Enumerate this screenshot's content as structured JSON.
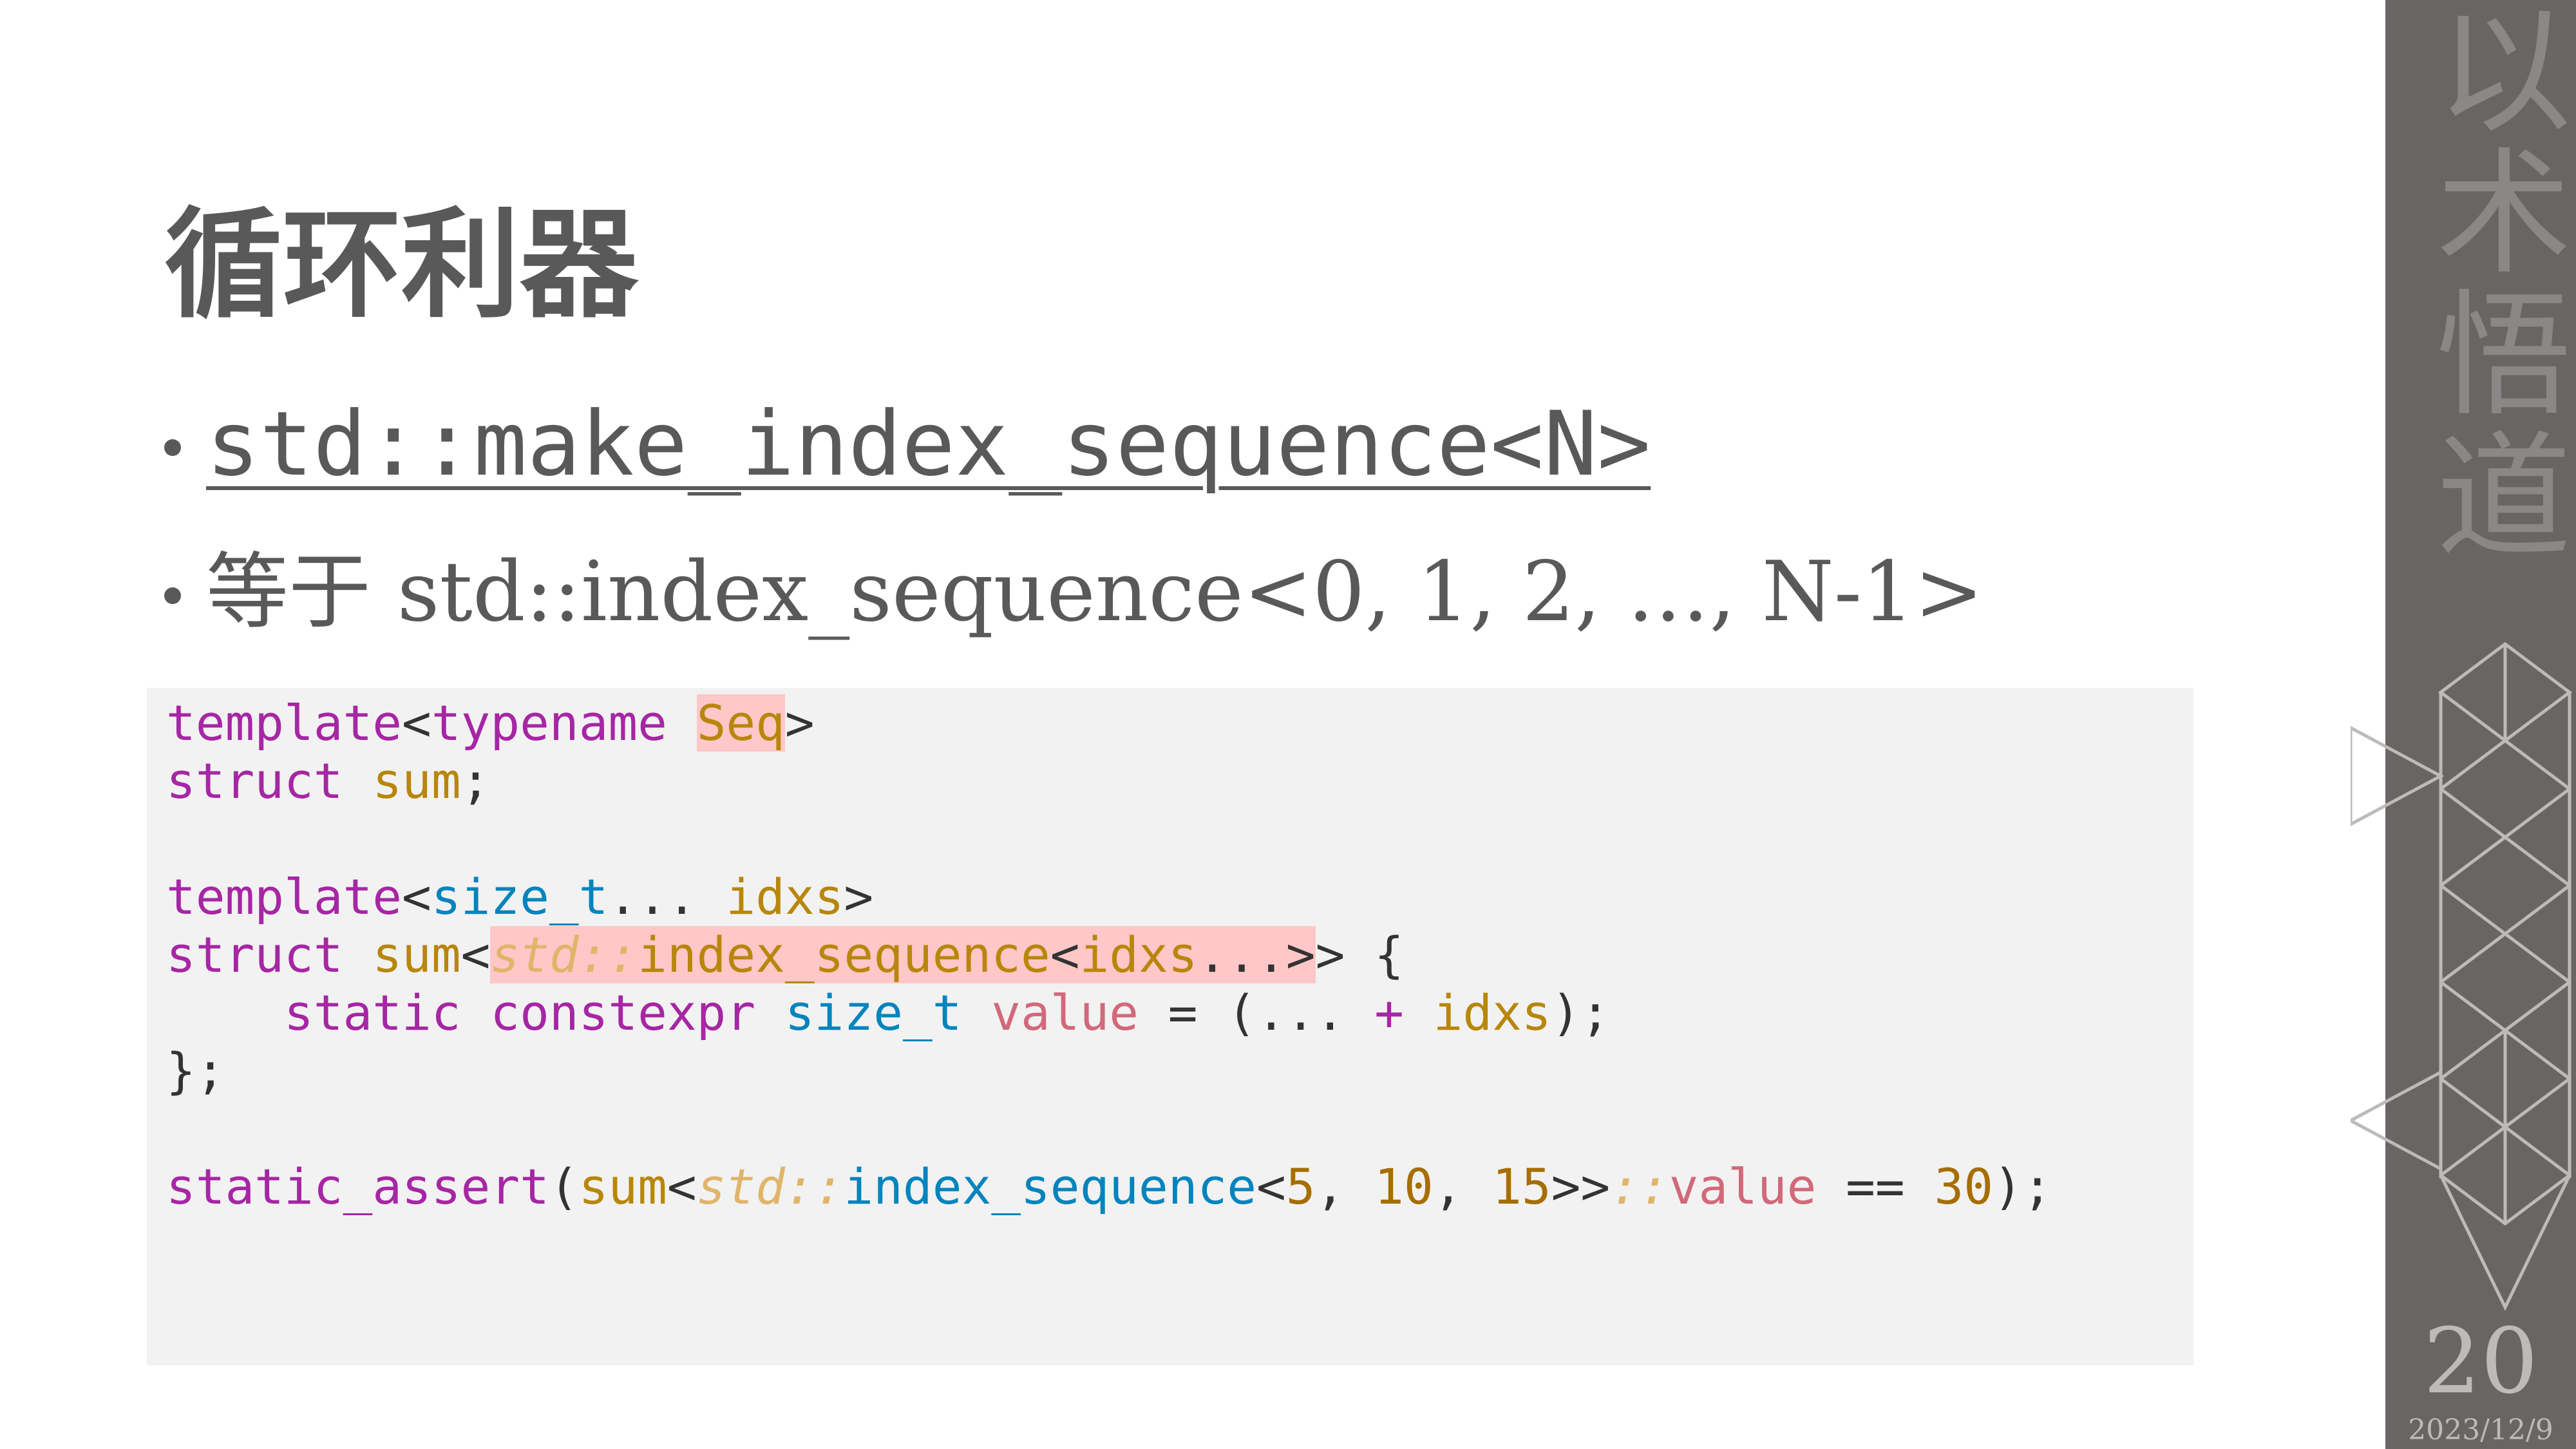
{
  "slide": {
    "title": "循环利器",
    "bullets": [
      "std::make_index_sequence<N>",
      "等于 std::index_sequence<0, 1, 2, …, N-1>"
    ],
    "code": {
      "l1": {
        "a": "template",
        "b": "<",
        "c": "typename",
        "d": " ",
        "e": "Seq",
        "f": ">"
      },
      "l2": {
        "a": "struct",
        "b": " ",
        "c": "sum",
        "d": ";"
      },
      "l4": {
        "a": "template",
        "b": "<",
        "c": "size_t",
        "d": "... ",
        "e": "idxs",
        "f": ">"
      },
      "l5": {
        "a": "struct",
        "b": " ",
        "c": "sum",
        "d": "<",
        "e": "std::",
        "f": "index_sequence",
        "g": "<",
        "h": "idxs",
        "i": "...>",
        "j": "> {"
      },
      "l6": {
        "a": "    ",
        "b": "static",
        "c": " ",
        "d": "constexpr",
        "e": " ",
        "f": "size_t",
        "g": " ",
        "h": "value",
        "i": " = (... ",
        "j": "+",
        "k": " ",
        "l": "idxs",
        "m": ");"
      },
      "l7": {
        "a": "};"
      },
      "l9": {
        "a": "static_assert",
        "b": "(",
        "c": "sum",
        "d": "<",
        "e": "std::",
        "f": "index_sequence",
        "g": "<",
        "h": "5",
        "i": ", ",
        "j": "10",
        "k": ", ",
        "l": "15",
        "m": ">>",
        "n": "::",
        "o": "value",
        "p": " == ",
        "q": "30",
        "r": ");"
      }
    }
  },
  "sidebar": {
    "vertical_text": "以术悟道",
    "page_number": "20",
    "date": "2023/12/9"
  },
  "colors": {
    "sidebar": "#686565",
    "code_background": "#f2f2f2",
    "keyword": "#a626a4",
    "type": "#0184bc",
    "name": "#b8860b",
    "highlight": "#ffc7c7"
  }
}
